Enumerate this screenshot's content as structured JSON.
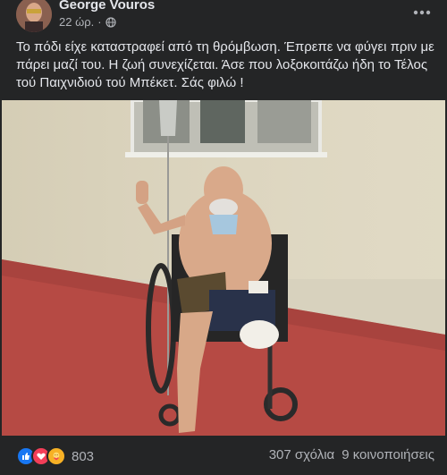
{
  "post": {
    "author": "George Vouros",
    "timestamp": "22 ώρ.",
    "privacy_icon": "globe-icon",
    "more_icon": "more-options-icon",
    "caption": "Το πόδι είχε καταστραφεί από τη θρόμβωση. Έπρεπε να φύγει πριν με πάρει μαζί του. Η ζωή συνεχίζεται. Άσε που λοξοκοιτάζω ήδη το Τέλος τού Παιχνιδιού τού Μπέκετ. Σάς φιλώ !"
  },
  "footer": {
    "reaction_icons": [
      "like-icon",
      "love-icon",
      "care-icon"
    ],
    "reaction_count": "803",
    "comments": "307 σχόλια",
    "shares": "9 κοινοποιήσεις"
  },
  "colors": {
    "background": "#242526",
    "text_primary": "#e4e6eb",
    "text_secondary": "#b0b3b8",
    "like_blue": "#1877f2",
    "love_red": "#f33e58",
    "care_yellow": "#f7b125"
  }
}
